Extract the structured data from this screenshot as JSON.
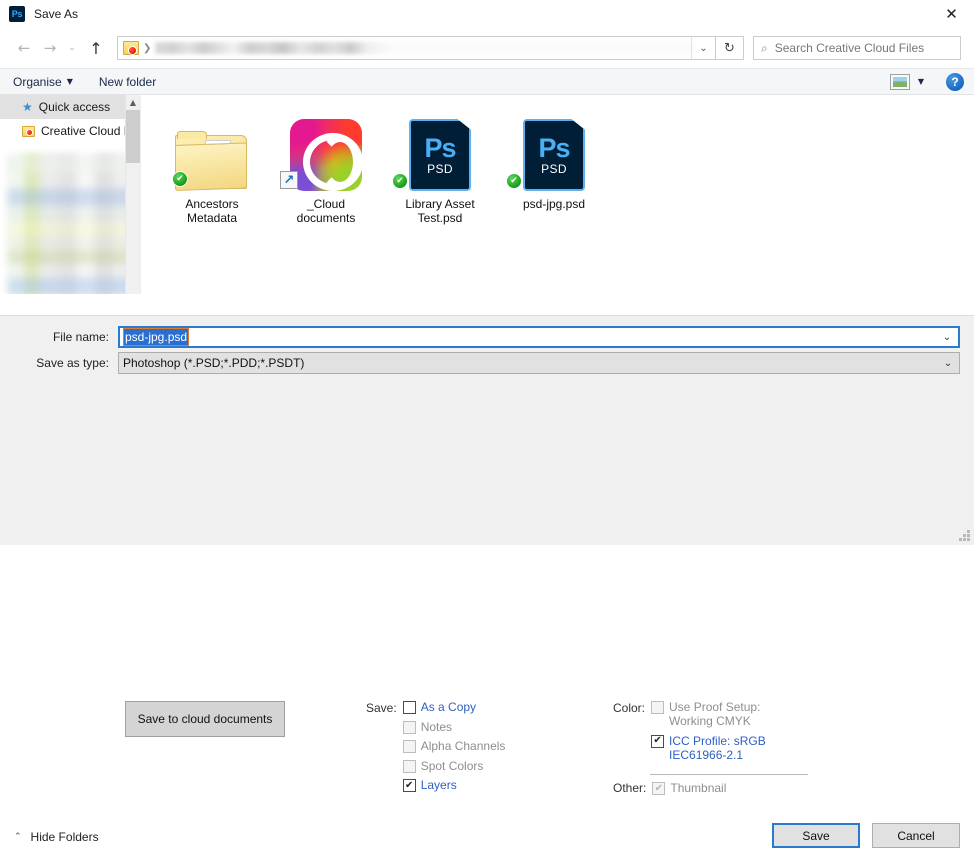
{
  "window": {
    "app_icon": "photoshop-icon",
    "app_icon_text": "Ps",
    "title": "Save As",
    "close_label": "✕"
  },
  "nav": {
    "back_icon": "←",
    "forward_icon": "→",
    "recent_icon": "⌄",
    "up_icon": "↑",
    "breadcrumb_sep": "❯",
    "address_dropdown_icon": "⌄",
    "refresh_icon": "↻",
    "path_value": ""
  },
  "search": {
    "icon": "⌕",
    "placeholder": "Search Creative Cloud Files"
  },
  "toolbar": {
    "organise_label": "Organise",
    "organise_caret": "▼",
    "new_folder_label": "New folder",
    "view_caret": "▼",
    "help_label": "?"
  },
  "sidebar": {
    "items": [
      {
        "label": "Quick access",
        "icon": "star-icon",
        "selected": true
      },
      {
        "label": "Creative Cloud Fil",
        "icon": "creative-cloud-folder-icon",
        "selected": false
      }
    ],
    "scroll_up_icon": "▲",
    "scroll_down_icon": "▼"
  },
  "files": [
    {
      "name": "Ancestors\nMetadata",
      "name_line1": "Ancestors",
      "name_line2": "Metadata",
      "kind": "folder",
      "synced": true
    },
    {
      "name": "_Cloud documents",
      "name_line1": "_Cloud",
      "name_line2": "documents",
      "kind": "creative-cloud-app",
      "shortcut": true,
      "shortcut_icon": "↗"
    },
    {
      "name": "Library Asset Test.psd",
      "name_line1": "Library Asset",
      "name_line2": "Test.psd",
      "kind": "psd",
      "badge_text": "Ps",
      "ext_text": "PSD",
      "synced": true
    },
    {
      "name": "psd-jpg.psd",
      "name_line1": "psd-jpg.psd",
      "name_line2": "",
      "kind": "psd",
      "badge_text": "Ps",
      "ext_text": "PSD",
      "synced": true
    }
  ],
  "sync_badge_glyph": "✔",
  "form": {
    "file_name_label": "File name:",
    "file_name_value": "psd-jpg.psd",
    "save_as_type_label": "Save as type:",
    "save_as_type_value": "Photoshop (*.PSD;*.PDD;*.PSDT)",
    "combo_caret": "⌄",
    "cloud_button_label": "Save to cloud documents"
  },
  "save_options": {
    "heading": "Save:",
    "items": [
      {
        "label": "As a Copy",
        "checked": false,
        "enabled": true
      },
      {
        "label": "Notes",
        "checked": false,
        "enabled": false
      },
      {
        "label": "Alpha Channels",
        "checked": false,
        "enabled": false
      },
      {
        "label": "Spot Colors",
        "checked": false,
        "enabled": false
      },
      {
        "label": "Layers",
        "checked": true,
        "enabled": true
      }
    ]
  },
  "color_options": {
    "heading": "Color:",
    "proof_line1": "Use Proof Setup:",
    "proof_line2": "Working CMYK",
    "proof_checked": false,
    "proof_enabled": false,
    "icc_line1": "ICC Profile:  sRGB",
    "icc_line2": "IEC61966-2.1",
    "icc_checked": true,
    "icc_enabled": true,
    "other_heading": "Other:",
    "thumbnail_label": "Thumbnail",
    "thumbnail_checked": true,
    "thumbnail_enabled": false
  },
  "footer": {
    "hide_folders_label": "Hide Folders",
    "hide_folders_caret": "⌃",
    "save_label": "Save",
    "cancel_label": "Cancel"
  },
  "check_glyph": "✔",
  "colors": {
    "accent_blue": "#2a7ad2",
    "link_blue": "#2f5fc4",
    "disabled_gray": "#8e8e8e",
    "panel_bg": "#f0f0f0",
    "psd_navy": "#001e36",
    "psd_blue": "#49b0f7",
    "sync_green": "#139a13"
  }
}
